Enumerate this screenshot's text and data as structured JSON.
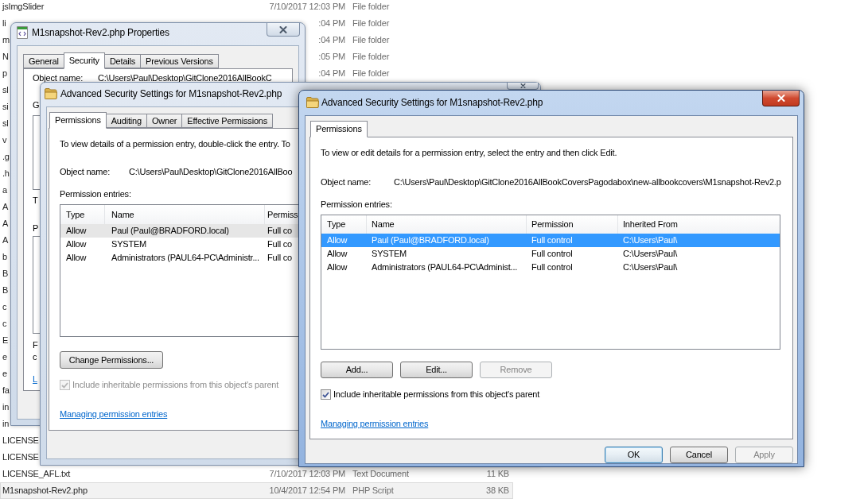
{
  "explorer": {
    "rows": [
      {
        "name": "jsImgSlider",
        "date": "7/10/2017 12:03 PM",
        "type": "File folder",
        "selected": false
      },
      {
        "name": "li",
        "date": ":04 PM",
        "type": "File folder",
        "selected": false
      },
      {
        "name": "m",
        "date": ":04 PM",
        "type": "File folder",
        "selected": false
      },
      {
        "name": "N",
        "date": ":05 PM",
        "type": "File folder",
        "selected": false
      },
      {
        "name": "p",
        "date": ":04 PM",
        "type": "File folder",
        "selected": false
      },
      {
        "name": "sl",
        "selected": false
      },
      {
        "name": "si",
        "selected": false
      },
      {
        "name": "sl",
        "selected": false
      },
      {
        "name": "v",
        "selected": false
      },
      {
        "name": ".g",
        "selected": false
      },
      {
        "name": ".h",
        "selected": false
      },
      {
        "name": "a",
        "selected": false
      },
      {
        "name": "A",
        "selected": false
      },
      {
        "name": "A",
        "selected": false
      },
      {
        "name": "A",
        "selected": false
      },
      {
        "name": "b",
        "selected": false
      },
      {
        "name": "B",
        "selected": false
      },
      {
        "name": "B",
        "selected": false
      },
      {
        "name": "c",
        "selected": false
      },
      {
        "name": "c",
        "selected": false
      },
      {
        "name": "E",
        "selected": false
      },
      {
        "name": "e",
        "selected": false
      },
      {
        "name": "e",
        "selected": false
      },
      {
        "name": "fa",
        "selected": false
      },
      {
        "name": "in",
        "selected": false
      },
      {
        "name": "in",
        "selected": false
      },
      {
        "name": "LICENSE",
        "selected": false
      },
      {
        "name": "LICENSE",
        "selected": false
      },
      {
        "name": "LICENSE_AFL.txt",
        "date": "7/10/2017 12:03 PM",
        "type": "Text Document",
        "size": "11 KB",
        "selected": false
      },
      {
        "name": "M1snapshot-Rev2.php",
        "date": "10/4/2017 12:54 PM",
        "type": "PHP Script",
        "size": "38 KB",
        "selected": true
      }
    ]
  },
  "properties_window": {
    "title": "M1snapshot-Rev2.php Properties",
    "active": false,
    "tabs": [
      {
        "label": "General",
        "selected": false
      },
      {
        "label": "Security",
        "selected": true
      },
      {
        "label": "Details",
        "selected": false
      },
      {
        "label": "Previous Versions",
        "selected": false
      }
    ],
    "object_name_label": "Object name:",
    "object_name": "C:\\Users\\Paul\\Desktop\\GitClone2016AllBookC",
    "fragments": [
      {
        "kind": "text",
        "text": "G"
      },
      {
        "kind": "text",
        "text": "T"
      },
      {
        "kind": "text",
        "text": "P"
      },
      {
        "kind": "text",
        "text": "F"
      },
      {
        "kind": "text",
        "text": "c"
      },
      {
        "kind": "link",
        "text": "L"
      }
    ]
  },
  "background_dialog": {
    "title": "Advanced Security Settings for M1snapshot-Rev2.php",
    "active": false,
    "tabs": [
      {
        "label": "Permissions",
        "selected": true
      },
      {
        "label": "Auditing",
        "selected": false
      },
      {
        "label": "Owner",
        "selected": false
      },
      {
        "label": "Effective Permissions",
        "selected": false
      }
    ],
    "instructions": "To view details of a permission entry, double-click the entry. To",
    "object_name_label": "Object name:",
    "object_name": "C:\\Users\\Paul\\Desktop\\GitClone2016AllBoo",
    "entries_label": "Permission entries:",
    "columns": [
      "Type",
      "Name",
      "Permiss"
    ],
    "rows": [
      {
        "type": "Allow",
        "name": "Paul (Paul@BRADFORD.local)",
        "permission": "Full co",
        "selected": true
      },
      {
        "type": "Allow",
        "name": "SYSTEM",
        "permission": "Full co",
        "selected": false
      },
      {
        "type": "Allow",
        "name": "Administrators (PAUL64-PC\\Administr...",
        "permission": "Full co",
        "selected": false
      }
    ],
    "buttons": [
      {
        "label": "Change Permissions...",
        "disabled": false
      }
    ],
    "inherit_checkbox": {
      "label": "Include inheritable permissions from this object's parent",
      "checked": true,
      "disabled": true
    },
    "help_link": "Managing permission entries"
  },
  "dialog": {
    "title": "Advanced Security Settings for M1snapshot-Rev2.php",
    "active": true,
    "tabs": [
      {
        "label": "Permissions",
        "selected": true
      }
    ],
    "instructions": "To view or edit details for a permission entry, select the entry and then click Edit.",
    "object_name_label": "Object name:",
    "object_name": "C:\\Users\\Paul\\Desktop\\GitClone2016AllBookCoversPagodabox\\new-allbookcovers\\M1snapshot-Rev2.p",
    "entries_label": "Permission entries:",
    "columns": [
      "Type",
      "Name",
      "Permission",
      "Inherited From"
    ],
    "rows": [
      {
        "type": "Allow",
        "name": "Paul (Paul@BRADFORD.local)",
        "permission": "Full control",
        "inherited_from": "C:\\Users\\Paul\\",
        "selected": true
      },
      {
        "type": "Allow",
        "name": "SYSTEM",
        "permission": "Full control",
        "inherited_from": "C:\\Users\\Paul\\",
        "selected": false
      },
      {
        "type": "Allow",
        "name": "Administrators (PAUL64-PC\\Administ...",
        "permission": "Full control",
        "inherited_from": "C:\\Users\\Paul\\",
        "selected": false
      }
    ],
    "buttons": [
      {
        "label": "Add...",
        "disabled": false
      },
      {
        "label": "Edit...",
        "disabled": false
      },
      {
        "label": "Remove",
        "disabled": true
      }
    ],
    "inherit_checkbox": {
      "label": "Include inheritable permissions from this object's parent",
      "checked": true,
      "disabled": false
    },
    "help_link": "Managing permission entries",
    "footer_buttons": [
      {
        "label": "OK",
        "default": true,
        "disabled": false
      },
      {
        "label": "Cancel",
        "default": false,
        "disabled": false
      },
      {
        "label": "Apply",
        "default": false,
        "disabled": true
      }
    ]
  }
}
